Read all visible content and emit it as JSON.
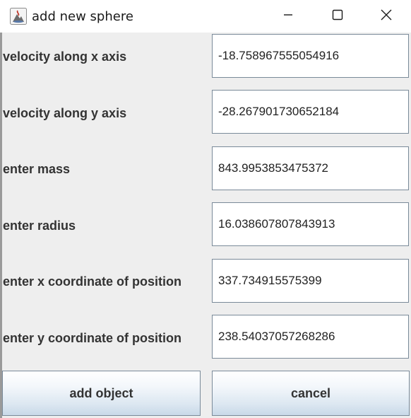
{
  "window": {
    "title": "add new sphere",
    "controls": {
      "minimize_icon": "minimize-icon",
      "maximize_icon": "maximize-icon",
      "close_icon": "close-icon"
    }
  },
  "form": {
    "rows": [
      {
        "label": "velocity along x axis",
        "value": "-18.758967555054916"
      },
      {
        "label": "velocity along y axis",
        "value": "-28.267901730652184"
      },
      {
        "label": "enter mass",
        "value": "843.9953853475372"
      },
      {
        "label": "enter radius",
        "value": "16.038607807843913"
      },
      {
        "label": "enter x coordinate of position",
        "value": "337.734915575399"
      },
      {
        "label": "enter y coordinate of position",
        "value": "238.54037057268286"
      }
    ]
  },
  "buttons": {
    "add_label": "add object",
    "cancel_label": "cancel"
  },
  "colors": {
    "window_bg": "#eeeeee",
    "field_border": "#7a8a99",
    "button_gradient_bottom": "#c9d9e8",
    "label_text": "#333333"
  }
}
